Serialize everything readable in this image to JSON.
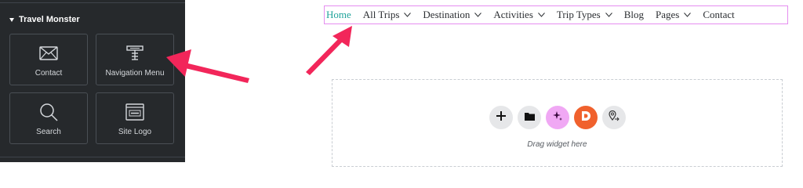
{
  "panel": {
    "category": "Travel Monster",
    "widgets": [
      {
        "label": "Contact",
        "icon": "envelope-icon"
      },
      {
        "label": "Navigation Menu",
        "icon": "nav-menu-icon"
      },
      {
        "label": "Search",
        "icon": "search-icon"
      },
      {
        "label": "Site Logo",
        "icon": "site-logo-icon"
      }
    ]
  },
  "nav": {
    "items": [
      {
        "label": "Home",
        "dropdown": false,
        "active": true
      },
      {
        "label": "All Trips",
        "dropdown": true
      },
      {
        "label": "Destination",
        "dropdown": true
      },
      {
        "label": "Activities",
        "dropdown": true
      },
      {
        "label": "Trip Types",
        "dropdown": true
      },
      {
        "label": "Blog",
        "dropdown": false
      },
      {
        "label": "Pages",
        "dropdown": true
      },
      {
        "label": "Contact",
        "dropdown": false
      }
    ],
    "active_color": "#1fa39b",
    "border_color": "#e58ef0"
  },
  "dropzone": {
    "hint": "Drag widget here",
    "buttons": [
      {
        "icon": "plus-icon",
        "color": "#e6e7e9"
      },
      {
        "icon": "folder-icon",
        "color": "#e6e7e9"
      },
      {
        "icon": "sparkle-ai-icon",
        "color": "#f0a8f4"
      },
      {
        "icon": "d-logo-icon",
        "color": "#f0612d"
      },
      {
        "icon": "location-icon",
        "color": "#e6e7e9"
      }
    ]
  },
  "annotation_color": "#f2265a"
}
